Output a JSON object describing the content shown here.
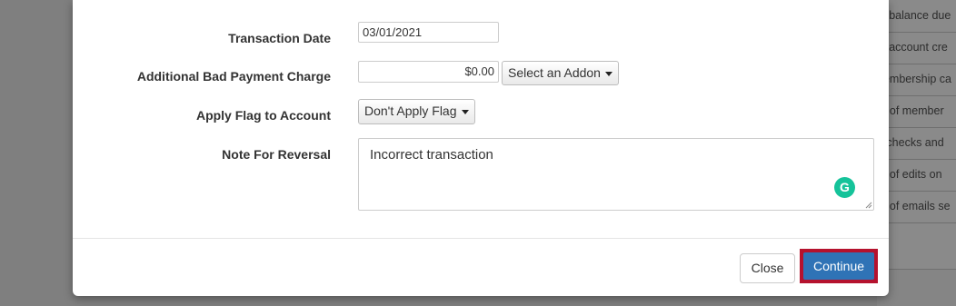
{
  "background": {
    "items": [
      "st balance due",
      "st account cre",
      "nembership ca",
      "ry of member",
      "d checks and",
      "ry of edits on",
      "ry of emails se"
    ]
  },
  "form": {
    "transaction_date": {
      "label": "Transaction Date",
      "value": "03/01/2021"
    },
    "bad_payment": {
      "label": "Additional Bad Payment Charge",
      "amount": "$0.00",
      "addon_select": "Select an Addon"
    },
    "flag": {
      "label": "Apply Flag to Account",
      "selected": "Don't Apply Flag"
    },
    "note": {
      "label": "Note For Reversal",
      "value": "Incorrect transaction"
    }
  },
  "footer": {
    "close_label": "Close",
    "continue_label": "Continue"
  },
  "colors": {
    "primary": "#2f73b6",
    "highlight_border": "#b5122e",
    "grammarly": "#15c39a"
  }
}
